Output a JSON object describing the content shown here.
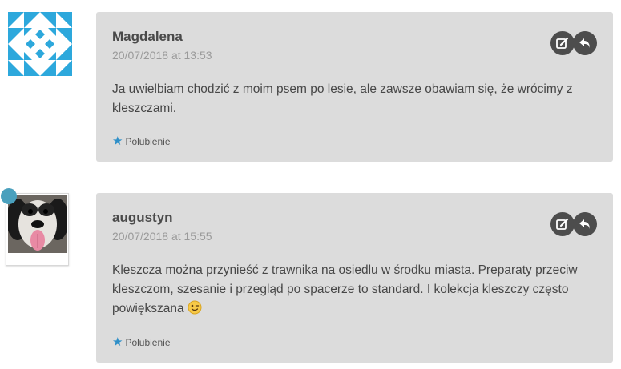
{
  "comments": [
    {
      "author": "Magdalena",
      "date": "20/07/2018 at 13:53",
      "text": "Ja uwielbiam chodzić z moim psem po lesie, ale zawsze obawiam się, że wrócimy z kleszczami.",
      "like_label": "Polubienie",
      "avatar_icon": "identicon-avatar"
    },
    {
      "author": "augustyn",
      "date": "20/07/2018 at 15:55",
      "text": "Kleszcza można przynieść z trawnika na osiedlu w środku miasta. Preparaty przeciw kleszczom, szesanie i przegląd po spacerze to standard. I kolekcja kleszczy często powiększana",
      "like_label": "Polubienie",
      "avatar_icon": "dog-photo-avatar"
    }
  ],
  "colors": {
    "card_bg": "#dcdcdc",
    "identicon": "#2da8dc",
    "star": "#2e8fc8",
    "button_bg": "#4d4d4d"
  },
  "icons": [
    "edit-icon",
    "reply-icon",
    "star-icon",
    "wink-emoji-icon"
  ]
}
